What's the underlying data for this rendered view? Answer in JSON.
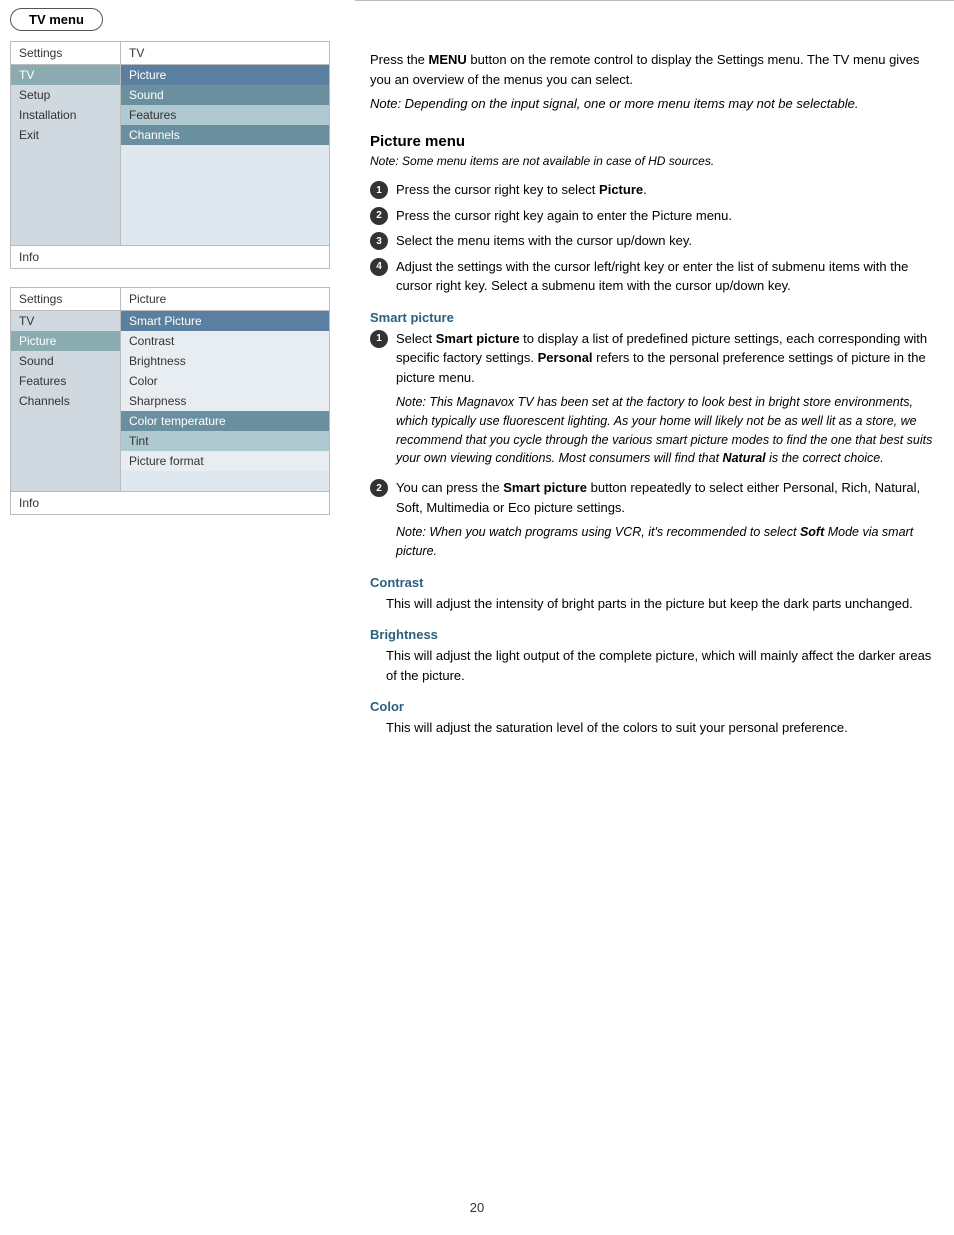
{
  "tvmenu": {
    "tab_label": "TV menu"
  },
  "menu1": {
    "header_left": "Settings",
    "header_right": "TV",
    "left_items": [
      {
        "label": "TV",
        "style": "selected"
      },
      {
        "label": "Setup",
        "style": "normal"
      },
      {
        "label": "Installation",
        "style": "normal"
      },
      {
        "label": "Exit",
        "style": "normal"
      },
      {
        "label": "",
        "style": "empty"
      },
      {
        "label": "",
        "style": "empty"
      },
      {
        "label": "",
        "style": "empty"
      },
      {
        "label": "",
        "style": "empty"
      },
      {
        "label": "",
        "style": "empty"
      }
    ],
    "right_items": [
      {
        "label": "Picture",
        "style": "highlighted"
      },
      {
        "label": "Sound",
        "style": "dark-selected"
      },
      {
        "label": "Features",
        "style": "light-selected"
      },
      {
        "label": "Channels",
        "style": "dark-selected"
      },
      {
        "label": "",
        "style": "empty"
      },
      {
        "label": "",
        "style": "empty"
      },
      {
        "label": "",
        "style": "empty"
      },
      {
        "label": "",
        "style": "empty"
      },
      {
        "label": "",
        "style": "empty"
      }
    ],
    "footer": "Info"
  },
  "menu2": {
    "header_left": "Settings",
    "header_right": "Picture",
    "left_items": [
      {
        "label": "TV",
        "style": "normal"
      },
      {
        "label": "Picture",
        "style": "selected"
      },
      {
        "label": "Sound",
        "style": "normal"
      },
      {
        "label": "Features",
        "style": "normal"
      },
      {
        "label": "Channels",
        "style": "normal"
      },
      {
        "label": "",
        "style": "empty"
      },
      {
        "label": "",
        "style": "empty"
      },
      {
        "label": "",
        "style": "empty"
      },
      {
        "label": "",
        "style": "empty"
      }
    ],
    "right_items": [
      {
        "label": "Smart Picture",
        "style": "highlighted"
      },
      {
        "label": "Contrast",
        "style": "normal"
      },
      {
        "label": "Brightness",
        "style": "normal"
      },
      {
        "label": "Color",
        "style": "normal"
      },
      {
        "label": "Sharpness",
        "style": "normal"
      },
      {
        "label": "Color temperature",
        "style": "dark-selected"
      },
      {
        "label": "Tint",
        "style": "light-selected"
      },
      {
        "label": "Picture format",
        "style": "normal"
      },
      {
        "label": "",
        "style": "empty"
      }
    ],
    "footer": "Info"
  },
  "content": {
    "intro": {
      "text1": "Press the ",
      "bold1": "MENU",
      "text2": " button on the remote control to display the Settings menu. The TV menu gives you an overview of the menus you can select.",
      "note": "Note: Depending on the input signal, one or more menu items may not be selectable."
    },
    "picture_menu": {
      "title": "Picture menu",
      "note": "Note: Some menu items are not available in case of HD sources.",
      "steps": [
        {
          "num": "1",
          "text": "Press the cursor right key to select ",
          "bold": "Picture",
          "text2": "."
        },
        {
          "num": "2",
          "text": "Press the cursor right key again to enter the Picture menu."
        },
        {
          "num": "3",
          "text": "Select the menu items with the cursor up/down key."
        },
        {
          "num": "4",
          "text": "Adjust the settings with the cursor left/right key or enter the list of submenu items with the cursor right key. Select a submenu item with the cursor up/down key."
        }
      ]
    },
    "smart_picture": {
      "title": "Smart picture",
      "step1_text": "Select ",
      "step1_bold": "Smart picture",
      "step1_text2": " to display a list of predefined picture settings, each corresponding with specific factory settings. ",
      "step1_bold2": "Personal",
      "step1_text3": " refers to the personal preference settings of picture in the picture menu.",
      "step1_note": "Note: This Magnavox TV has been set at the factory to look best in bright store environments, which typically use fluorescent lighting. As your home will likely not be as well lit as a store, we recommend that you cycle through the various smart picture modes to find the one that best suits your own viewing conditions. Most consumers will find that ",
      "step1_note_bold": "Natural",
      "step1_note_end": " is the correct choice.",
      "step2_text": "You can press the ",
      "step2_bold": "Smart picture",
      "step2_text2": " button repeatedly to select either Personal, Rich, Natural, Soft, Multimedia or Eco picture settings.",
      "step2_note": "Note: When you watch programs using VCR, it's recommended to select ",
      "step2_note_bold": "Soft",
      "step2_note_end": " Mode via smart picture."
    },
    "contrast": {
      "title": "Contrast",
      "body": "This will adjust the intensity of bright parts in the picture but keep the dark parts unchanged."
    },
    "brightness": {
      "title": "Brightness",
      "body": "This will adjust the light output of the complete picture, which will mainly affect the darker areas of the picture."
    },
    "color": {
      "title": "Color",
      "body": "This will adjust the saturation level of the colors to suit your personal preference."
    }
  },
  "page_number": "20"
}
